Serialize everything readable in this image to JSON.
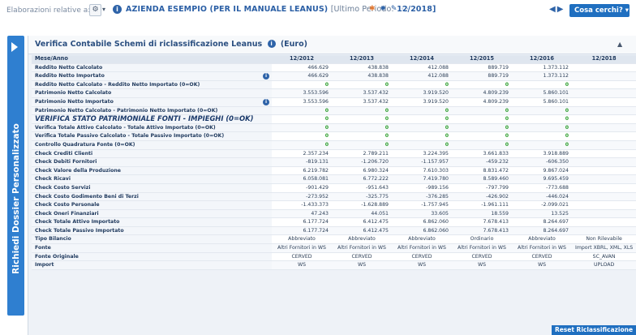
{
  "header": {
    "context_label": "Elaborazioni relative a:",
    "company": "AZIENDA ESEMPIO (PER IL MANUALE LEANUS)",
    "period_label": "[Ultimo Periodo:",
    "period_value": "12/2018]",
    "search_button": "Cosa cerchi?",
    "nav": "◀▶"
  },
  "sidebar": {
    "label": "Richiedi Dossier Personalizzato"
  },
  "panel": {
    "title": "Verifica Contabile Schemi di riclassificazione Leanus",
    "unit": "(Euro)"
  },
  "table": {
    "header_label": "Mese/Anno",
    "columns": [
      "12/2012",
      "12/2013",
      "12/2014",
      "12/2015",
      "12/2016",
      "12/2018"
    ],
    "rows": [
      {
        "label": "Reddito Netto Calcolato",
        "values": [
          "466.629",
          "438.838",
          "412.088",
          "889.719",
          "1.373.112",
          ""
        ]
      },
      {
        "label": "Reddito Netto Importato",
        "info": true,
        "values": [
          "466.629",
          "438.838",
          "412.088",
          "889.719",
          "1.373.112",
          ""
        ]
      },
      {
        "label": "Reddito Netto Calcolato - Reddito Netto Importato (0=OK)",
        "ok": true,
        "values": [
          "0",
          "0",
          "0",
          "0",
          "0",
          ""
        ]
      },
      {
        "label": "Patrimonio Netto Calcolato",
        "values": [
          "3.553.596",
          "3.537.432",
          "3.919.520",
          "4.809.239",
          "5.860.101",
          ""
        ]
      },
      {
        "label": "Patrimonio Netto Importato",
        "info": true,
        "values": [
          "3.553.596",
          "3.537.432",
          "3.919.520",
          "4.809.239",
          "5.860.101",
          ""
        ]
      },
      {
        "label": "Patrimonio Netto Calcolato - Patrimonio Netto Importato (0=OK)",
        "ok": true,
        "values": [
          "0",
          "0",
          "0",
          "0",
          "0",
          ""
        ]
      },
      {
        "label": "VERIFICA STATO PATRIMONIALE FONTI - IMPIEGHI (0=OK)",
        "ok": true,
        "big": true,
        "values": [
          "0",
          "0",
          "0",
          "0",
          "0",
          ""
        ]
      },
      {
        "label": "Verifica Totale Attivo Calcolato - Totale Attivo Importato (0=OK)",
        "ok": true,
        "values": [
          "0",
          "0",
          "0",
          "0",
          "0",
          ""
        ]
      },
      {
        "label": "Verifica Totale Passivo Calcolato - Totale Passivo Importato (0=OK)",
        "ok": true,
        "values": [
          "0",
          "0",
          "0",
          "0",
          "0",
          ""
        ]
      },
      {
        "label": "Controllo Quadratura Fonte (0=OK)",
        "ok": true,
        "values": [
          "0",
          "0",
          "0",
          "0",
          "0",
          ""
        ]
      },
      {
        "label": "Check Crediti Clienti",
        "values": [
          "2.357.234",
          "2.789.211",
          "3.224.395",
          "3.661.833",
          "3.918.889",
          ""
        ]
      },
      {
        "label": "Check Debiti Fornitori",
        "values": [
          "-819.131",
          "-1.206.720",
          "-1.157.957",
          "-459.232",
          "-606.350",
          ""
        ]
      },
      {
        "label": "Check Valore della Produzione",
        "values": [
          "6.219.782",
          "6.980.324",
          "7.610.303",
          "8.831.472",
          "9.867.024",
          ""
        ]
      },
      {
        "label": "Check Ricavi",
        "values": [
          "6.058.081",
          "6.772.222",
          "7.419.780",
          "8.589.460",
          "9.695.459",
          ""
        ]
      },
      {
        "label": "Check Costo Servizi",
        "values": [
          "-901.429",
          "-951.643",
          "-989.156",
          "-797.799",
          "-773.688",
          ""
        ]
      },
      {
        "label": "Check Costo Godimento Beni di Terzi",
        "values": [
          "-273.952",
          "-325.775",
          "-376.285",
          "-426.902",
          "-446.024",
          ""
        ]
      },
      {
        "label": "Check Costo Personale",
        "values": [
          "-1.433.373",
          "-1.628.889",
          "-1.757.945",
          "-1.961.111",
          "-2.099.021",
          ""
        ]
      },
      {
        "label": "Check Oneri Finanziari",
        "values": [
          "47.243",
          "44.051",
          "33.605",
          "18.559",
          "13.525",
          ""
        ]
      },
      {
        "label": "Check Totale Attivo Importato",
        "values": [
          "6.177.724",
          "6.412.475",
          "6.862.060",
          "7.678.413",
          "8.264.697",
          ""
        ]
      },
      {
        "label": "Check Totale Passivo Importato",
        "values": [
          "6.177.724",
          "6.412.475",
          "6.862.060",
          "7.678.413",
          "8.264.697",
          ""
        ]
      },
      {
        "label": "Tipo Bilancio",
        "text": true,
        "values": [
          "Abbreviato",
          "Abbreviato",
          "Abbreviato",
          "Ordinario",
          "Abbreviato",
          "Non Rilevabile"
        ]
      },
      {
        "label": "Fonte",
        "text": true,
        "values": [
          "Altri Fornitori in WS",
          "Altri Fornitori in WS",
          "Altri Fornitori in WS",
          "Altri Fornitori in WS",
          "Altri Fornitori in WS",
          "Import XBRL, XML, XLS"
        ]
      },
      {
        "label": "Fonte Originale",
        "text": true,
        "values": [
          "CERVED",
          "CERVED",
          "CERVED",
          "CERVED",
          "CERVED",
          "SC_AVAN"
        ]
      },
      {
        "label": "Import",
        "text": true,
        "values": [
          "WS",
          "WS",
          "WS",
          "WS",
          "WS",
          "UPLOAD"
        ]
      }
    ]
  },
  "footer": {
    "reset_button": "Reset Riclassificazione"
  },
  "colors": {
    "accent": "#1f6fc0",
    "ok_green": "#2a9d2a",
    "header_bg": "#dfe6ef"
  }
}
